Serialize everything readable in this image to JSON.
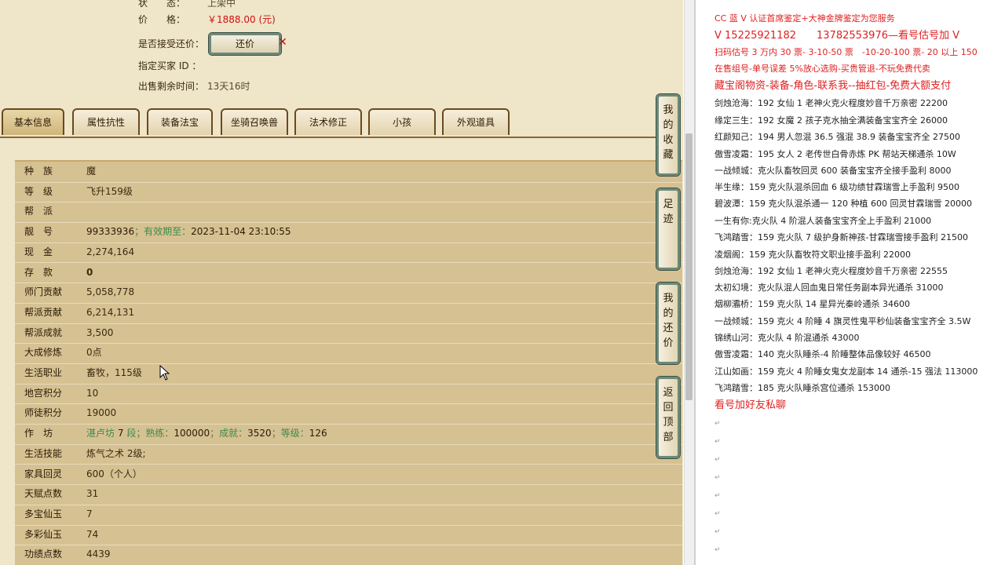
{
  "header": {
    "status_label": "状　　态：",
    "status_value": "上架中",
    "price_label": "价　　格：",
    "price_value": "￥1888.00 (元)",
    "counter_label": "是否接受还价：",
    "counter_button": "还价",
    "counter_close": "✕",
    "buyer_label": "指定买家 ID ：",
    "buyer_value": "",
    "remain_label": "出售剩余时间：",
    "remain_value": "13天16时"
  },
  "tabs": [
    "基本信息",
    "属性抗性",
    "装备法宝",
    "坐骑召唤兽",
    "法术修正",
    "小孩",
    "外观道具"
  ],
  "rows": [
    {
      "k": "种　族",
      "v": "魔"
    },
    {
      "k": "等　级",
      "v": "飞升159级"
    },
    {
      "k": "帮　派",
      "v": ""
    },
    {
      "k": "靓　号",
      "v": "99333936",
      "v2": "；有效期至：",
      "v3": "2023-11-04 23:10:55"
    },
    {
      "k": "现　金",
      "v": "2,274,164"
    },
    {
      "k": "存　款",
      "v": "0"
    },
    {
      "k": "师门贡献",
      "v": "5,058,778"
    },
    {
      "k": "帮派贡献",
      "v": "6,214,131"
    },
    {
      "k": "帮派成就",
      "v": "3,500"
    },
    {
      "k": "大成修炼",
      "v": "0点"
    },
    {
      "k": "生活职业",
      "v": "畜牧，115级"
    },
    {
      "k": "地宫积分",
      "v": "10"
    },
    {
      "k": "师徒积分",
      "v": "19000"
    },
    {
      "k": "作　坊",
      "v": "湛卢坊",
      "v2": "7",
      "v3": "段；熟练：",
      "v4": "100000",
      "v5": "；成就：",
      "v6": "3520",
      "v7": "；等级：",
      "v8": "126"
    },
    {
      "k": "生活技能",
      "v": "炼气之术 2级;"
    },
    {
      "k": "家具回灵",
      "v": "600（个人）"
    },
    {
      "k": "天赋点数",
      "v": "31"
    },
    {
      "k": "多宝仙玉",
      "v": "7"
    },
    {
      "k": "多彩仙玉",
      "v": "74"
    },
    {
      "k": "功绩点数",
      "v": "4439"
    }
  ],
  "side_buttons": [
    "我的收藏",
    "足迹",
    "我的还价",
    "返回顶部"
  ],
  "right_lines": [
    {
      "t": "CC 蓝 V 认证首席鉴定+大神金牌鉴定为您服务",
      "c": "red"
    },
    {
      "t": "V 15225921182　　13782553976—看号估号加 V",
      "c": "red big"
    },
    {
      "t": "扫码估号 3 万内 30 票- 3-10-50 票　-10-20-100 票- 20 以上 150",
      "c": "red"
    },
    {
      "t": "在售组号-单号误差 5%放心选购-买贵管退-不玩免费代卖",
      "c": "red"
    },
    {
      "t": "藏宝阁物资-装备-角色-联系我--抽红包-免费大额支付",
      "c": "red big"
    },
    {
      "t": "剑烛沧海：192 女仙 1 老神火克火程度妙音千万亲密 22200",
      "c": ""
    },
    {
      "t": "缘定三生：192 女魔 2 孩子克水抽全满装备宝宝齐全 26000",
      "c": ""
    },
    {
      "t": "红颜知己：194 男人忽混 36.5 强混 38.9 装备宝宝齐全 27500",
      "c": ""
    },
    {
      "t": "傲雪凌霜：195 女人 2 老传世白骨赤炼 PK 帮站天梯通杀 10W",
      "c": ""
    },
    {
      "t": "一战倾城：克火队畜牧回灵 600 装备宝宝齐全接手盈利 8000",
      "c": ""
    },
    {
      "t": "半生缘：159 克火队混杀回血 6 级功绩甘霖瑞雪上手盈利 9500",
      "c": ""
    },
    {
      "t": "碧波潭：159 克火队混杀通一 120 种植 600 回灵甘霖瑞雪 20000",
      "c": ""
    },
    {
      "t": "一生有你:克火队 4 阶混人装备宝宝齐全上手盈利 21000",
      "c": ""
    },
    {
      "t": "飞鸿踏雪：159 克火队 7 级护身新神孩-甘霖瑞雪接手盈利 21500",
      "c": ""
    },
    {
      "t": "凌烟阁：159 克火队畜牧符文职业接手盈利 22000",
      "c": ""
    },
    {
      "t": "剑烛沧海：192 女仙 1 老神火克火程度妙音千万亲密 22555",
      "c": ""
    },
    {
      "t": "太初幻境：克火队混人回血鬼日常任务副本异光通杀 31000",
      "c": ""
    },
    {
      "t": "烟柳灞桥：159 克火队 14 星异光秦岭通杀 34600",
      "c": ""
    },
    {
      "t": "一战倾城：159 克火 4 阶睡 4 旗灵性鬼平秒仙装备宝宝齐全 3.5W",
      "c": ""
    },
    {
      "t": "锦绣山河：克火队 4 阶混通杀 43000",
      "c": ""
    },
    {
      "t": "傲雪凌霜：140 克火队睡杀-4 阶睡整体品像较好 46500",
      "c": ""
    },
    {
      "t": "江山如画：159 克火 4 阶睡女鬼女龙副本 14 通杀-15 强法 113000",
      "c": ""
    },
    {
      "t": "飞鸿踏雪：185 克火队睡杀宫位通杀 153000",
      "c": ""
    },
    {
      "t": "看号加好友私聊",
      "c": "red big"
    }
  ],
  "return_mark": "↵",
  "colors": {
    "panel_bg": "#efe5c8",
    "info_bg": "#d6c193",
    "accent_red": "#e02020",
    "btn_border": "#6b8a78"
  }
}
